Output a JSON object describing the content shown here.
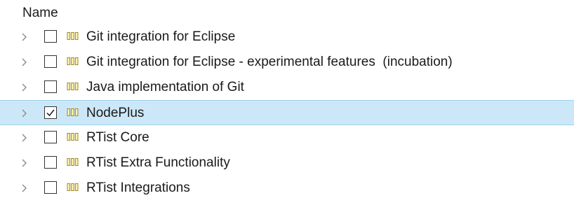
{
  "header": {
    "name": "Name"
  },
  "items": [
    {
      "label": "Git integration for Eclipse",
      "checked": false,
      "selected": false
    },
    {
      "label": "Git integration for Eclipse - experimental features  (incubation)",
      "checked": false,
      "selected": false
    },
    {
      "label": "Java implementation of Git",
      "checked": false,
      "selected": false
    },
    {
      "label": "NodePlus",
      "checked": true,
      "selected": true
    },
    {
      "label": "RTist Core",
      "checked": false,
      "selected": false
    },
    {
      "label": "RTist Extra Functionality",
      "checked": false,
      "selected": false
    },
    {
      "label": "RTist Integrations",
      "checked": false,
      "selected": false
    }
  ],
  "icons": {
    "expand": "chevron-right-icon",
    "feature": "feature-icon",
    "check": "checkmark-icon"
  },
  "colors": {
    "selection_bg": "#cce8f8",
    "selection_border": "#99d1f0",
    "feature_icon": "#9a8a2e"
  }
}
